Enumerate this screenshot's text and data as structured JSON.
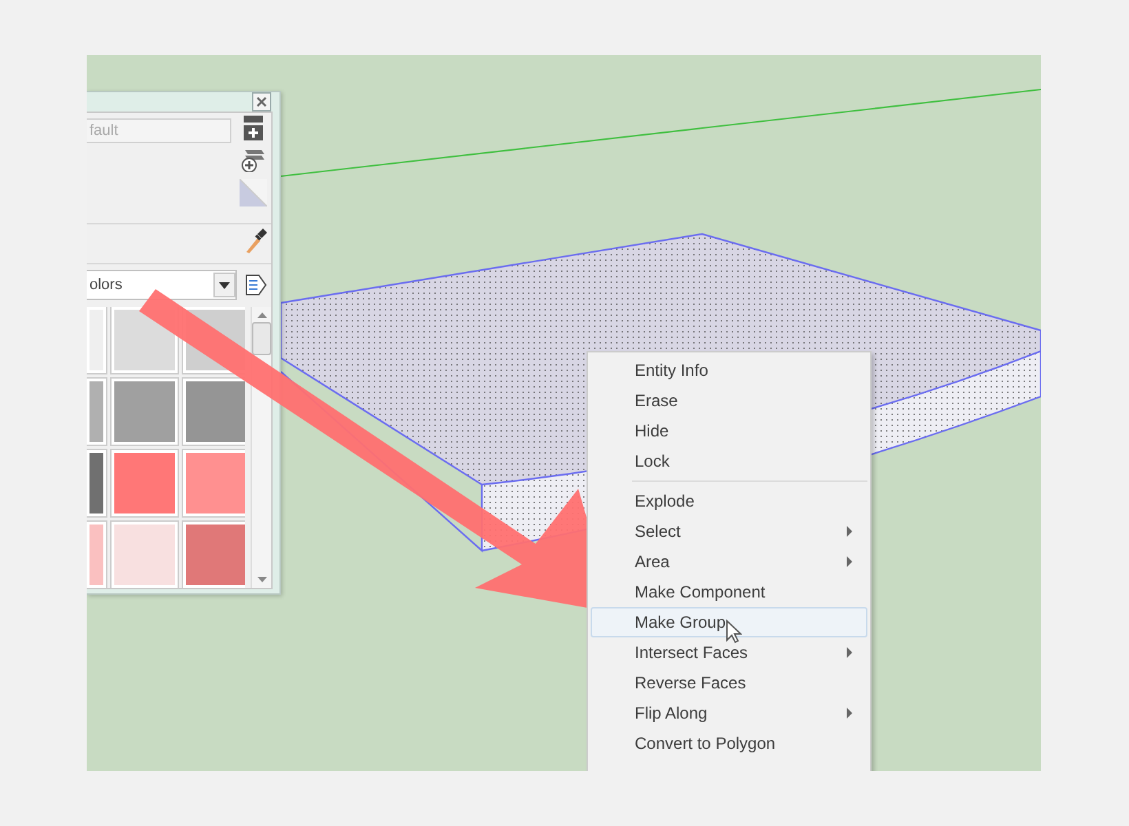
{
  "materials_panel": {
    "name_field": "fault",
    "library": "olors",
    "swatches": [
      {
        "color": "#efefef"
      },
      {
        "color": "#dcdcdc"
      },
      {
        "color": "#cfcfcf"
      },
      {
        "color": "#b0b0b0"
      },
      {
        "color": "#a0a0a0"
      },
      {
        "color": "#959595"
      },
      {
        "color": "#707070"
      },
      {
        "color": "#ff7777"
      },
      {
        "color": "#ff9090"
      },
      {
        "color": "#fac0c0"
      },
      {
        "color": "#f8e0e0"
      },
      {
        "color": "#e07878"
      }
    ]
  },
  "context_menu": {
    "groups": [
      [
        {
          "label": "Entity Info",
          "submenu": false,
          "selected": false
        },
        {
          "label": "Erase",
          "submenu": false,
          "selected": false
        },
        {
          "label": "Hide",
          "submenu": false,
          "selected": false
        },
        {
          "label": "Lock",
          "submenu": false,
          "selected": false
        }
      ],
      [
        {
          "label": "Explode",
          "submenu": false,
          "selected": false
        },
        {
          "label": "Select",
          "submenu": true,
          "selected": false
        },
        {
          "label": "Area",
          "submenu": true,
          "selected": false
        },
        {
          "label": "Make Component",
          "submenu": false,
          "selected": false
        },
        {
          "label": "Make Group",
          "submenu": false,
          "selected": true
        },
        {
          "label": "Intersect Faces",
          "submenu": true,
          "selected": false
        },
        {
          "label": "Reverse Faces",
          "submenu": false,
          "selected": false
        },
        {
          "label": "Flip Along",
          "submenu": true,
          "selected": false
        },
        {
          "label": "Convert to Polygon",
          "submenu": false,
          "selected": false
        }
      ]
    ]
  }
}
